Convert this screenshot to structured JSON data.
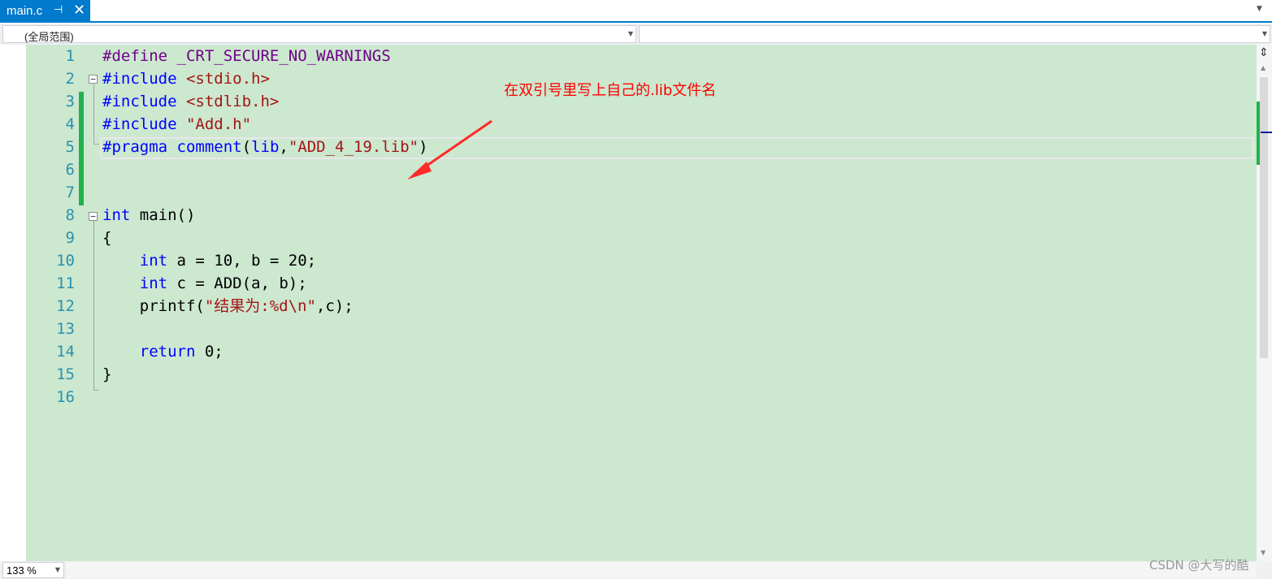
{
  "tab": {
    "title": "main.c",
    "pin_icon": "⊣",
    "close_icon": "✕"
  },
  "navbar": {
    "scope": "(全局范围)",
    "member": ""
  },
  "editor": {
    "lines": [
      {
        "n": "1",
        "t": [
          {
            "c": "pp",
            "s": "#define"
          },
          {
            "c": "",
            "s": " "
          },
          {
            "c": "pp",
            "s": "_CRT_SECURE_NO_WARNINGS"
          }
        ]
      },
      {
        "n": "2",
        "t": [
          {
            "c": "kw",
            "s": "#include"
          },
          {
            "c": "",
            "s": " "
          },
          {
            "c": "str",
            "s": "<stdio.h>"
          }
        ]
      },
      {
        "n": "3",
        "t": [
          {
            "c": "kw",
            "s": "#include"
          },
          {
            "c": "",
            "s": " "
          },
          {
            "c": "str",
            "s": "<stdlib.h>"
          }
        ]
      },
      {
        "n": "4",
        "t": [
          {
            "c": "kw",
            "s": "#include"
          },
          {
            "c": "",
            "s": " "
          },
          {
            "c": "str",
            "s": "\"Add.h\""
          }
        ]
      },
      {
        "n": "5",
        "t": [
          {
            "c": "kw",
            "s": "#pragma"
          },
          {
            "c": "",
            "s": " "
          },
          {
            "c": "kw",
            "s": "comment"
          },
          {
            "c": "",
            "s": "("
          },
          {
            "c": "kw",
            "s": "lib"
          },
          {
            "c": "",
            "s": ","
          },
          {
            "c": "str",
            "s": "\"ADD_4_19.lib\""
          },
          {
            "c": "",
            "s": ")"
          }
        ]
      },
      {
        "n": "6",
        "t": []
      },
      {
        "n": "7",
        "t": []
      },
      {
        "n": "8",
        "t": [
          {
            "c": "kw",
            "s": "int"
          },
          {
            "c": "",
            "s": " main()"
          }
        ]
      },
      {
        "n": "9",
        "t": [
          {
            "c": "",
            "s": "{"
          }
        ]
      },
      {
        "n": "10",
        "t": [
          {
            "c": "",
            "s": "    "
          },
          {
            "c": "kw",
            "s": "int"
          },
          {
            "c": "",
            "s": " a = 10, b = 20;"
          }
        ]
      },
      {
        "n": "11",
        "t": [
          {
            "c": "",
            "s": "    "
          },
          {
            "c": "kw",
            "s": "int"
          },
          {
            "c": "",
            "s": " c = ADD(a, b);"
          }
        ]
      },
      {
        "n": "12",
        "t": [
          {
            "c": "",
            "s": "    printf("
          },
          {
            "c": "str",
            "s": "\"结果为:%d\\n\""
          },
          {
            "c": "",
            "s": ",c);"
          }
        ]
      },
      {
        "n": "13",
        "t": []
      },
      {
        "n": "14",
        "t": [
          {
            "c": "",
            "s": "    "
          },
          {
            "c": "kw",
            "s": "return"
          },
          {
            "c": "",
            "s": " 0;"
          }
        ]
      },
      {
        "n": "15",
        "t": [
          {
            "c": "",
            "s": "}"
          }
        ]
      },
      {
        "n": "16",
        "t": []
      }
    ],
    "annotation": "在双引号里写上自己的.lib文件名"
  },
  "statusbar": {
    "zoom": "133 %"
  },
  "watermark": "CSDN @大写的酷",
  "colors": {
    "accent": "#007acc",
    "editor_bg": "#cce8cf",
    "keyword": "#0000ff",
    "preprocessor": "#6f008a",
    "string": "#a31515",
    "line_number": "#2b91af",
    "changed_margin": "#22b14c",
    "annotation": "#ff0000"
  }
}
